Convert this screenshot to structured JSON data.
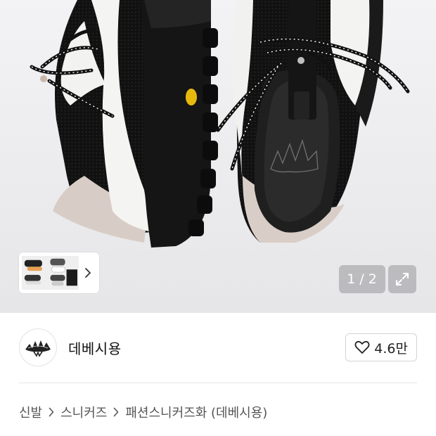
{
  "gallery": {
    "image_description_icon": "sneaker-photo-icon",
    "current_index": "1",
    "separator": "/",
    "total": "2",
    "thumbnail_count": 2
  },
  "store": {
    "name": "데베시용",
    "like_count": "4.6만"
  },
  "breadcrumb": {
    "items": [
      "신발",
      "스니커즈",
      "패션스니커즈화 (데베시용)"
    ]
  },
  "colors": {
    "counter_bg": "#aaaaaf",
    "border": "#d4d4d4",
    "text": "#222222"
  }
}
